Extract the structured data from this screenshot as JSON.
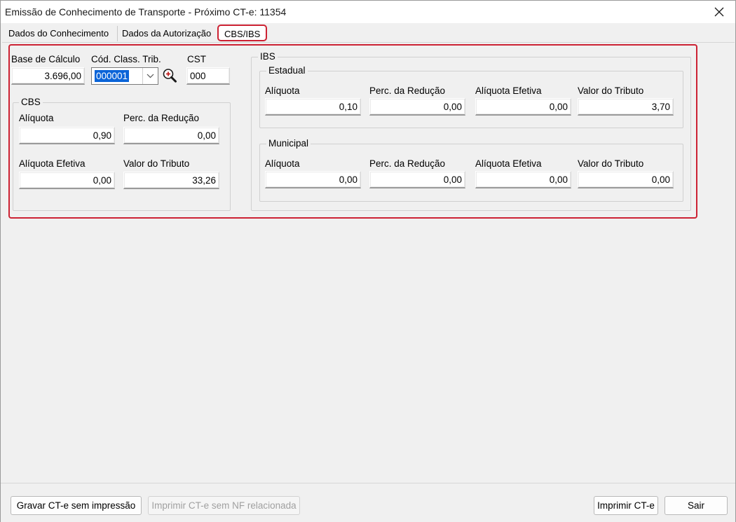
{
  "window": {
    "title": "Emissão de Conhecimento de Transporte - Próximo CT-e: 11354",
    "close_icon": "close-icon"
  },
  "tabs": [
    {
      "label": "Dados do Conhecimento",
      "active": false
    },
    {
      "label": "Dados da Autorização",
      "active": false
    },
    {
      "label": "CBS/IBS",
      "active": true
    }
  ],
  "top_fields": {
    "base_calculo": {
      "label": "Base de Cálculo",
      "value": "3.696,00"
    },
    "cod_class_trib": {
      "label": "Cód. Class. Trib.",
      "value": "000001"
    },
    "cst": {
      "label": "CST",
      "value": "000"
    }
  },
  "cbs": {
    "title": "CBS",
    "aliquota": {
      "label": "Alíquota",
      "value": "0,90"
    },
    "perc_reducao": {
      "label": "Perc. da Redução",
      "value": "0,00"
    },
    "aliquota_efetiva": {
      "label": "Alíquota Efetiva",
      "value": "0,00"
    },
    "valor_tributo": {
      "label": "Valor do Tributo",
      "value": "33,26"
    }
  },
  "ibs": {
    "title": "IBS",
    "estadual": {
      "title": "Estadual",
      "aliquota": {
        "label": "Alíquota",
        "value": "0,10"
      },
      "perc_reducao": {
        "label": "Perc. da Redução",
        "value": "0,00"
      },
      "aliquota_efetiva": {
        "label": "Alíquota Efetiva",
        "value": "0,00"
      },
      "valor_tributo": {
        "label": "Valor do Tributo",
        "value": "3,70"
      }
    },
    "municipal": {
      "title": "Municipal",
      "aliquota": {
        "label": "Alíquota",
        "value": "0,00"
      },
      "perc_reducao": {
        "label": "Perc. da Redução",
        "value": "0,00"
      },
      "aliquota_efetiva": {
        "label": "Alíquota Efetiva",
        "value": "0,00"
      },
      "valor_tributo": {
        "label": "Valor do Tributo",
        "value": "0,00"
      }
    }
  },
  "buttons": {
    "gravar": "Gravar CT-e sem impressão",
    "imprimir_sem_nf": "Imprimir CT-e sem NF relacionada",
    "imprimir": "Imprimir CT-e",
    "sair": "Sair"
  },
  "colors": {
    "highlight": "#cc2233",
    "selection": "#0a64d8",
    "background": "#f0f0f0"
  },
  "icons": {
    "dropdown": "chevron-down-icon",
    "search": "zoom-in-icon"
  }
}
